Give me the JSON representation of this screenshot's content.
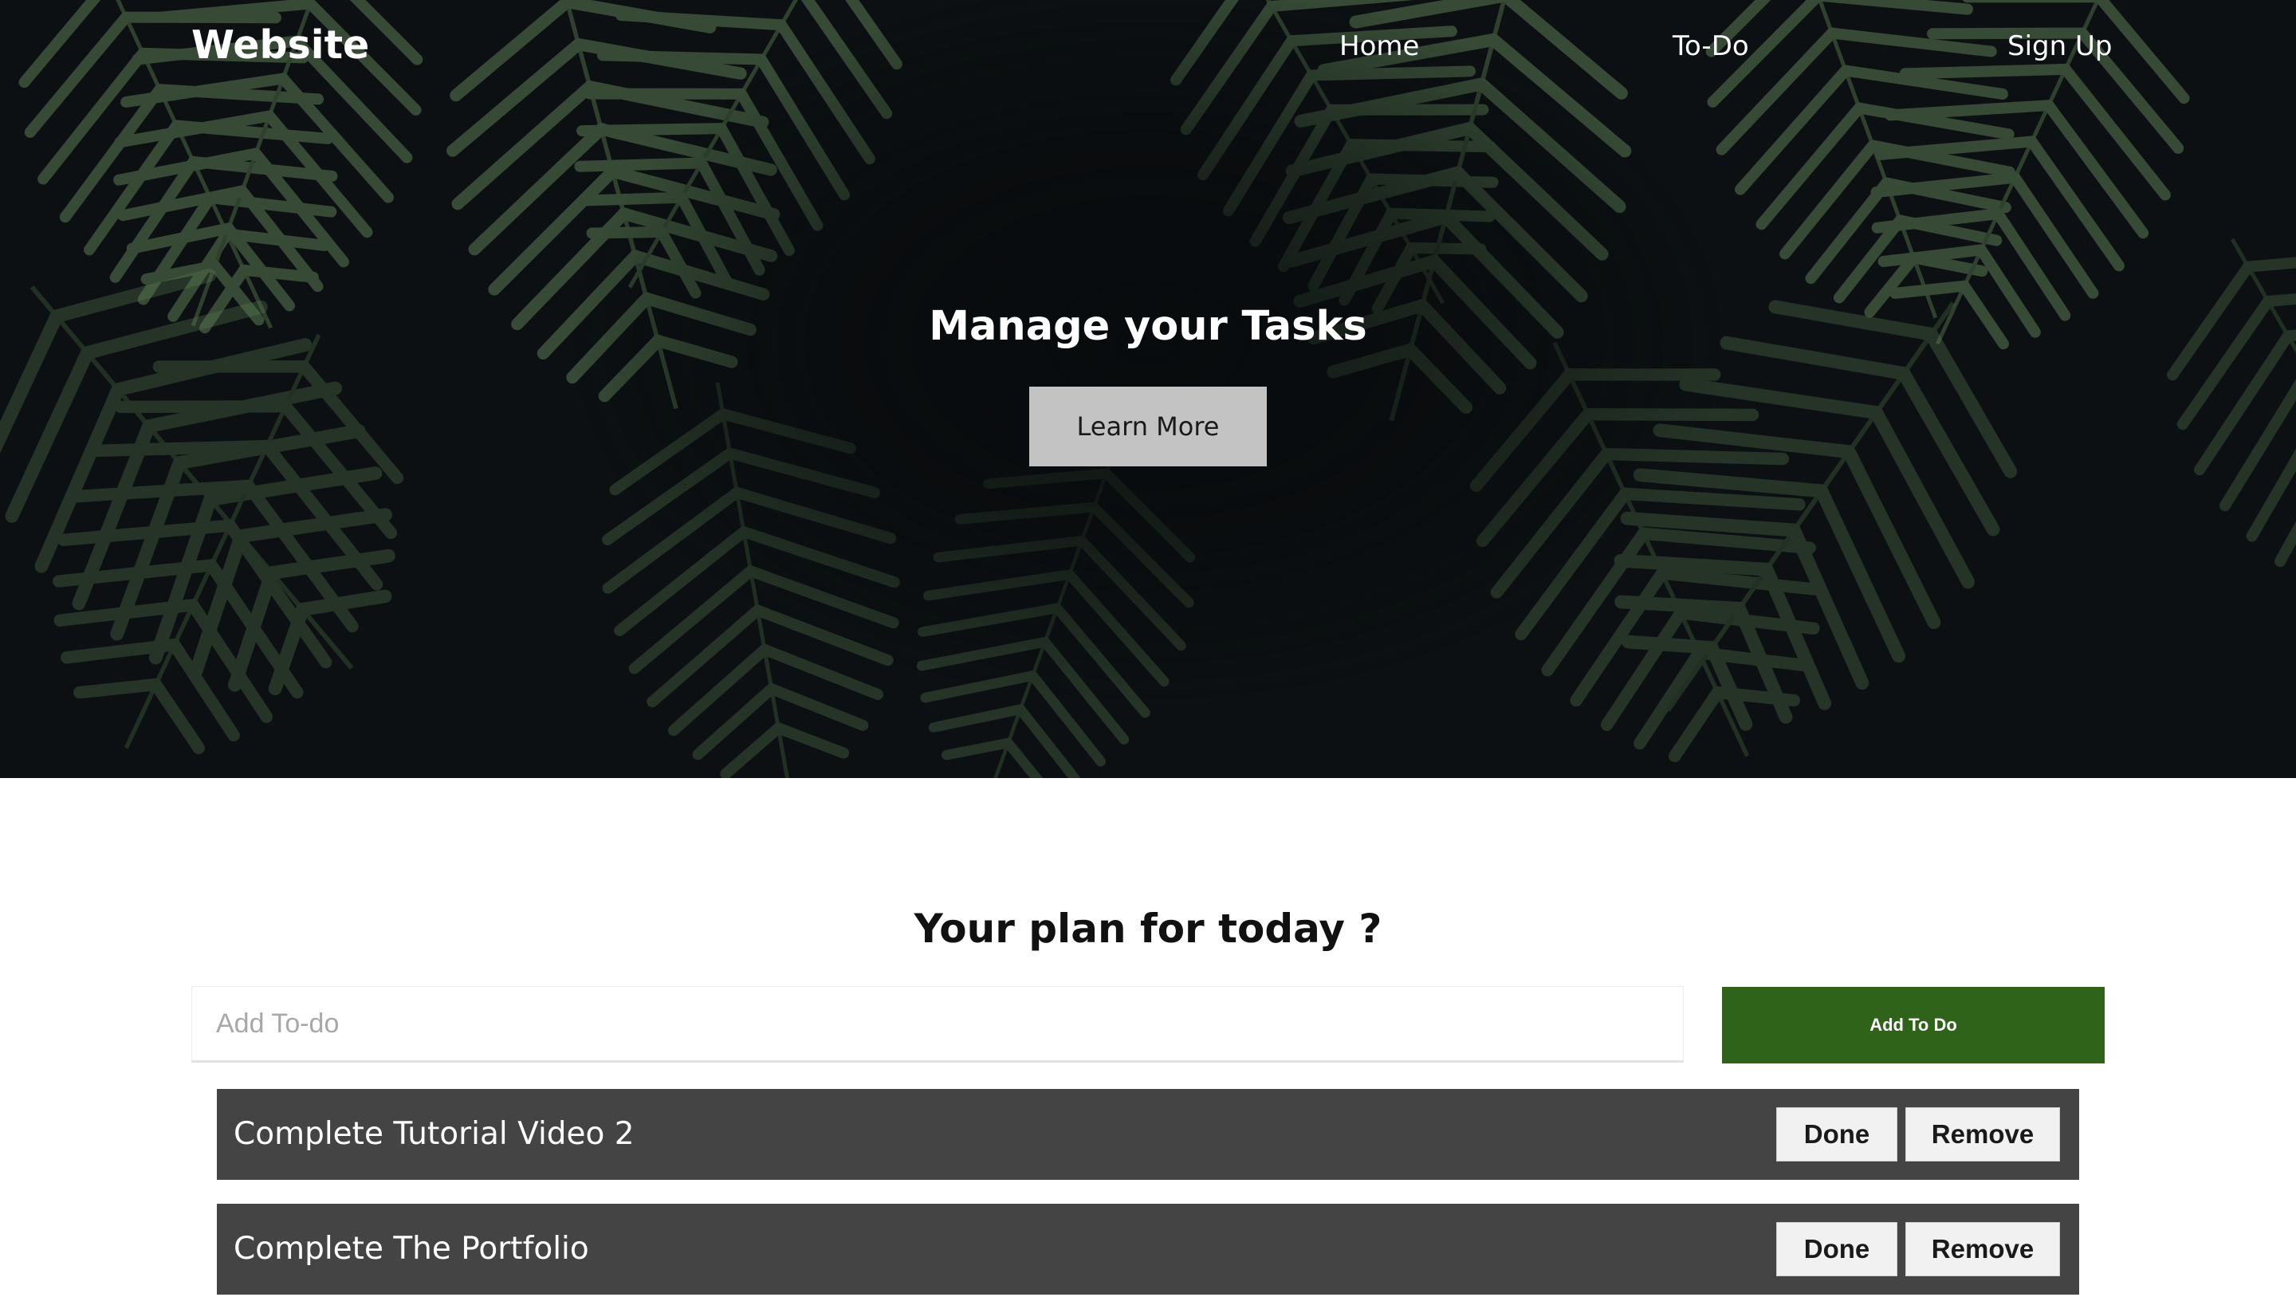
{
  "header": {
    "brand": "Website",
    "nav": [
      "Home",
      "To-Do",
      "Sign Up"
    ]
  },
  "hero": {
    "title": "Manage your Tasks",
    "button_label": "Learn More",
    "background": "dark tropical palm leaves"
  },
  "main": {
    "title": "Your plan for today ?",
    "input_placeholder": "Add To-do",
    "add_button_label": "Add To Do",
    "todos": [
      {
        "text": "Complete Tutorial Video 2",
        "done_label": "Done",
        "remove_label": "Remove"
      },
      {
        "text": "Complete The Portfolio",
        "done_label": "Done",
        "remove_label": "Remove"
      }
    ]
  },
  "colors": {
    "accent": "#2e6319",
    "todo_bg": "#444444",
    "hero_bg": "#0c1012"
  }
}
